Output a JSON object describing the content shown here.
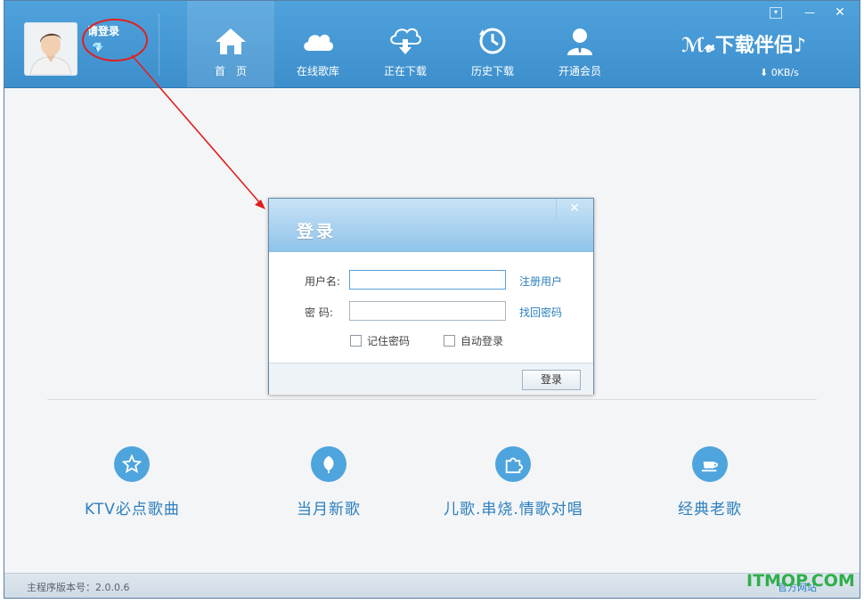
{
  "header": {
    "login_link": "请登录",
    "nav": [
      {
        "label": "首　页",
        "icon": "home-icon"
      },
      {
        "label": "在线歌库",
        "icon": "cloud-icon"
      },
      {
        "label": "正在下载",
        "icon": "download-cloud-icon"
      },
      {
        "label": "历史下载",
        "icon": "history-icon"
      },
      {
        "label": "开通会员",
        "icon": "member-icon"
      }
    ],
    "logo": "ℳ𝓿下载伴侣♪",
    "speed": "0KB/s",
    "window_buttons": [
      "menu-icon",
      "minimize-icon",
      "close-icon"
    ]
  },
  "dialog": {
    "title": "登录",
    "username_label": "用户名:",
    "username_value": "",
    "password_label": "密  码:",
    "password_value": "",
    "register_link": "注册用户",
    "recover_link": "找回密码",
    "remember_label": "记住密码",
    "autologin_label": "自动登录",
    "submit_label": "登录",
    "close_symbol": "✕"
  },
  "categories": [
    {
      "label": "KTV必点歌曲",
      "icon": "star-icon"
    },
    {
      "label": "当月新歌",
      "icon": "leaf-icon"
    },
    {
      "label": "儿歌.串烧.情歌对唱",
      "icon": "puzzle-icon"
    },
    {
      "label": "经典老歌",
      "icon": "coffee-cup-icon"
    }
  ],
  "statusbar": {
    "version": "主程序版本号：2.0.0.6",
    "official_site": "官方网站"
  },
  "watermark": "ITMOP.COM",
  "colors": {
    "header_blue": "#3d8fcc",
    "accent": "#2b7fbf",
    "annotation_red": "#e02020"
  }
}
